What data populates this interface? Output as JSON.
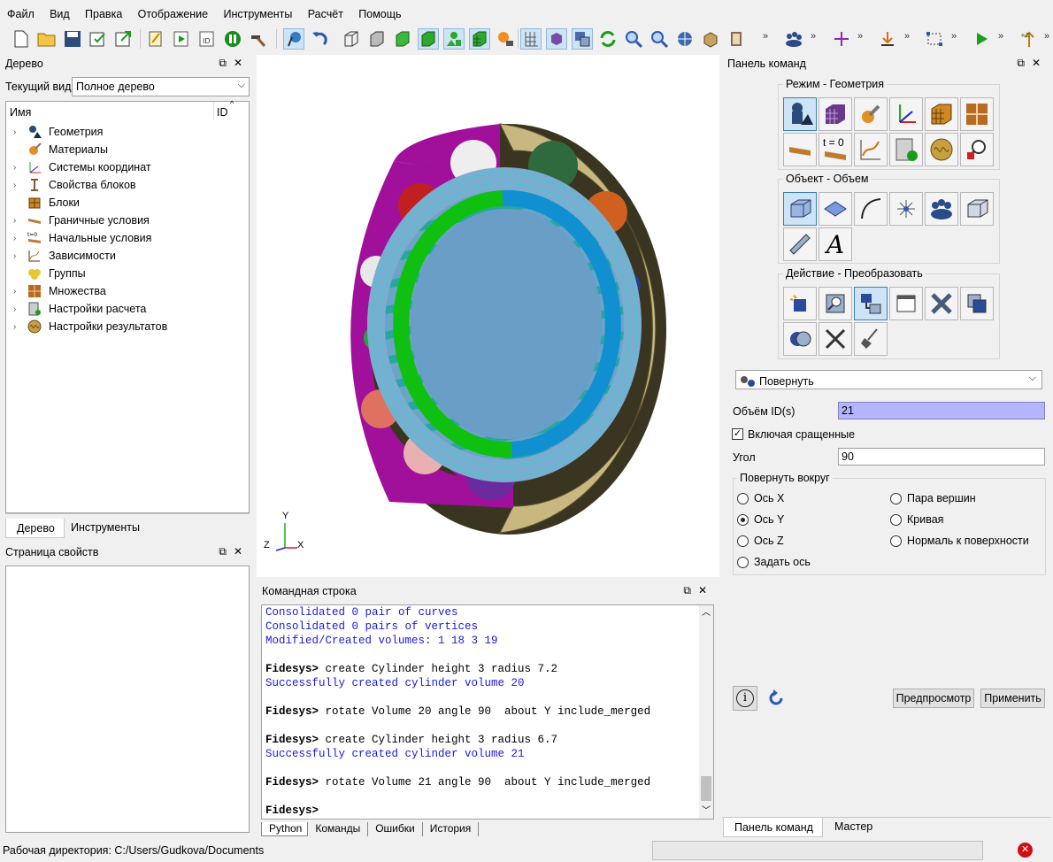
{
  "menu": [
    "Файл",
    "Вид",
    "Правка",
    "Отображение",
    "Инструменты",
    "Расчёт",
    "Помощь"
  ],
  "tree_panel": {
    "title": "Дерево",
    "current_view_label": "Текущий вид",
    "current_view_value": "Полное дерево",
    "col_name": "Имя",
    "col_id": "ID",
    "items": [
      {
        "label": "Геометрия",
        "icon": "geometry-icon",
        "expandable": true
      },
      {
        "label": "Материалы",
        "icon": "materials-icon",
        "expandable": false
      },
      {
        "label": "Системы координат",
        "icon": "coordinate-systems-icon",
        "expandable": true
      },
      {
        "label": "Свойства блоков",
        "icon": "block-properties-icon",
        "expandable": true
      },
      {
        "label": "Блоки",
        "icon": "blocks-icon",
        "expandable": false
      },
      {
        "label": "Граничные условия",
        "icon": "boundary-conditions-icon",
        "expandable": true
      },
      {
        "label": "Начальные условия",
        "icon": "initial-conditions-icon",
        "expandable": true
      },
      {
        "label": "Зависимости",
        "icon": "dependencies-icon",
        "expandable": true
      },
      {
        "label": "Группы",
        "icon": "groups-icon",
        "expandable": false
      },
      {
        "label": "Множества",
        "icon": "sets-icon",
        "expandable": true
      },
      {
        "label": "Настройки расчета",
        "icon": "calc-settings-icon",
        "expandable": true
      },
      {
        "label": "Настройки результатов",
        "icon": "results-settings-icon",
        "expandable": true
      }
    ],
    "tabs": [
      "Дерево",
      "Инструменты"
    ]
  },
  "property_panel": {
    "title": "Страница свойств"
  },
  "console": {
    "title": "Командная строка",
    "lines": [
      {
        "text": "Consolidated 0 pair of curves",
        "style": "blue"
      },
      {
        "text": "Consolidated 0 pairs of vertices",
        "style": "blue"
      },
      {
        "text": "Modified/Created volumes: 1 18 3 19",
        "style": "blue"
      },
      {
        "text": "",
        "style": "plain"
      },
      {
        "prompt": "Fidesys>",
        "text": " create Cylinder height 3 radius 7.2",
        "style": "cmd"
      },
      {
        "text": "Successfully created cylinder volume 20",
        "style": "blue"
      },
      {
        "text": "",
        "style": "plain"
      },
      {
        "prompt": "Fidesys>",
        "text": " rotate Volume 20 angle 90  about Y include_merged",
        "style": "cmd"
      },
      {
        "text": "",
        "style": "plain"
      },
      {
        "prompt": "Fidesys>",
        "text": " create Cylinder height 3 radius 6.7",
        "style": "cmd"
      },
      {
        "text": "Successfully created cylinder volume 21",
        "style": "blue"
      },
      {
        "text": "",
        "style": "plain"
      },
      {
        "prompt": "Fidesys>",
        "text": " rotate Volume 21 angle 90  about Y include_merged",
        "style": "cmd"
      },
      {
        "text": "",
        "style": "plain"
      },
      {
        "prompt": "Fidesys>",
        "text": "",
        "style": "cmd"
      }
    ],
    "tabs": [
      "Python",
      "Команды",
      "Ошибки",
      "История"
    ]
  },
  "command_panel": {
    "title": "Панель команд",
    "mode_title": "Режим - Геометрия",
    "object_title": "Объект - Объем",
    "action_title": "Действие - Преобразовать",
    "t0_label": "t = 0",
    "operation": "Повернуть",
    "volume_ids_label": "Объём ID(s)",
    "volume_ids_value": "21",
    "include_merged_label": "Включая сращенные",
    "include_merged_checked": true,
    "angle_label": "Угол",
    "angle_value": "90",
    "rotate_about_title": "Повернуть вокруг",
    "options": [
      {
        "label": "Ось X",
        "checked": false
      },
      {
        "label": "Ось Y",
        "checked": true
      },
      {
        "label": "Ось Z",
        "checked": false
      },
      {
        "label": "Задать ось",
        "checked": false
      },
      {
        "label": "Пара вершин",
        "checked": false
      },
      {
        "label": "Кривая",
        "checked": false
      },
      {
        "label": "Нормаль к поверхности",
        "checked": false
      }
    ],
    "preview_label": "Предпросмотр",
    "apply_label": "Применить",
    "tabs": [
      "Панель команд",
      "Мастер"
    ]
  },
  "axes": {
    "y": "Y",
    "z": "Z",
    "x": "X"
  },
  "status_bar": {
    "working_dir": "Рабочая директория: C:/Users/Gudkova/Documents"
  },
  "colors": {
    "selection": "#cde4f7",
    "input_highlight": "#b4b4ff",
    "console_blue": "#1a1ae0"
  }
}
